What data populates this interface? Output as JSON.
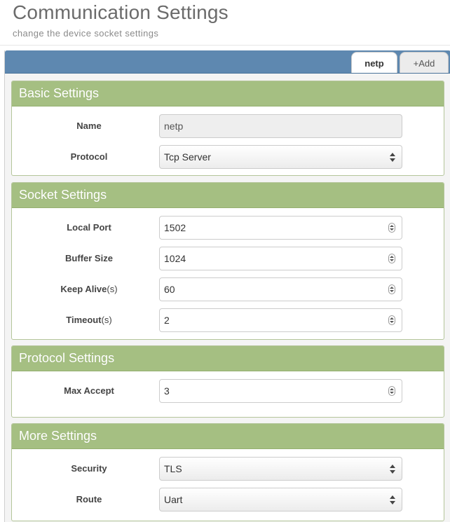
{
  "header": {
    "title": "Communication Settings",
    "subtitle": "change the device socket settings"
  },
  "tabs": [
    {
      "label": "netp",
      "active": true
    },
    {
      "label": "+Add",
      "active": false
    }
  ],
  "basic": {
    "heading": "Basic Settings",
    "name_label": "Name",
    "name_value": "netp",
    "protocol_label": "Protocol",
    "protocol_value": "Tcp Server"
  },
  "socket": {
    "heading": "Socket Settings",
    "local_port_label": "Local Port",
    "local_port_value": "1502",
    "buffer_size_label": "Buffer Size",
    "buffer_size_value": "1024",
    "keep_alive_label": "Keep Alive",
    "keep_alive_unit": "(s)",
    "keep_alive_value": "60",
    "timeout_label": "Timeout",
    "timeout_unit": "(s)",
    "timeout_value": "2"
  },
  "protocol": {
    "heading": "Protocol Settings",
    "max_accept_label": "Max Accept",
    "max_accept_value": "3"
  },
  "more": {
    "heading": "More Settings",
    "security_label": "Security",
    "security_value": "TLS",
    "route_label": "Route",
    "route_value": "Uart"
  },
  "colors": {
    "panel_heading": "#a5bf82",
    "tab_bar": "#5e88b0"
  }
}
